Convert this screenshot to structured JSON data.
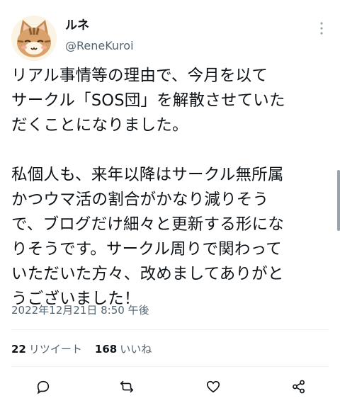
{
  "tweet": {
    "author": {
      "display_name": "ルネ",
      "handle": "@ReneKuroi",
      "avatar_icon": "cat-avatar-icon"
    },
    "text": "リアル事情等の理由で、今月を以て\nサークル「SOS団」を解散させていた\nだくことになりました。\n\n私個人も、来年以降はサークル無所属\nかつウマ活の割合がかなり減りそう\nで、ブログだけ細々と更新する形にな\nりそうです。サークル周りで関わって\nいただいた方々、改めましてありがと\nうございました！",
    "timestamp": "2022年12月21日 8:50 午後",
    "stats": {
      "retweets_count": "22",
      "retweets_label": "リツイート",
      "likes_count": "168",
      "likes_label": "いいね"
    },
    "actions": [
      "reply-icon",
      "retweet-icon",
      "like-icon",
      "share-icon"
    ]
  },
  "colors": {
    "text": "#0f1419",
    "secondary": "#536471",
    "divider": "#eff3f4"
  }
}
